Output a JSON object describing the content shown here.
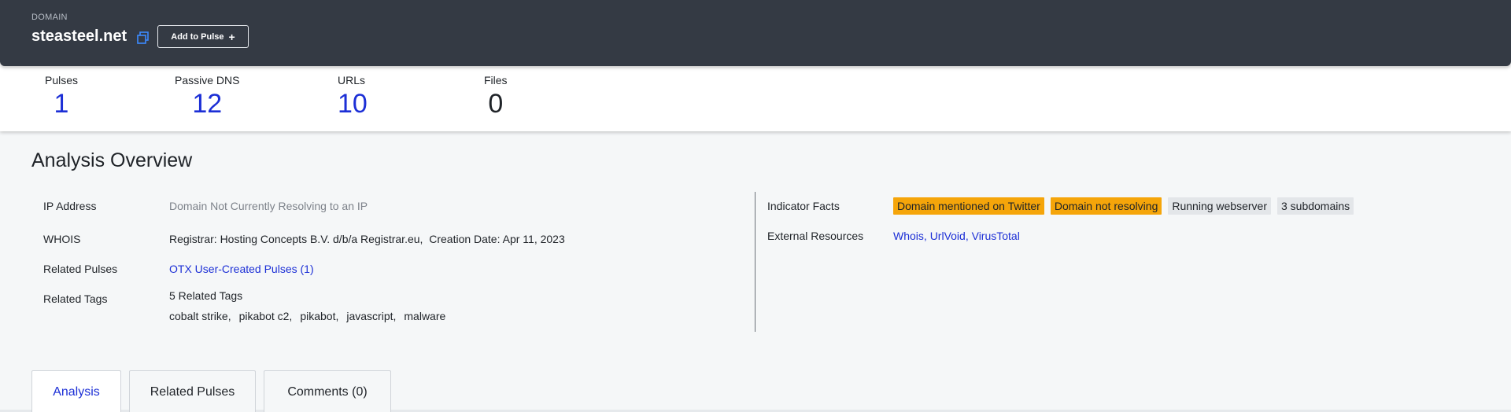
{
  "header": {
    "type_label": "DOMAIN",
    "domain": "steasteel.net",
    "add_button_label": "Add to Pulse",
    "copy_icon": "copy-icon",
    "plus_icon": "+"
  },
  "stats": {
    "pulses": {
      "label": "Pulses",
      "value": "1"
    },
    "passive_dns": {
      "label": "Passive DNS",
      "value": "12"
    },
    "urls": {
      "label": "URLs",
      "value": "10"
    },
    "files": {
      "label": "Files",
      "value": "0"
    }
  },
  "overview": {
    "title": "Analysis Overview",
    "ip_address": {
      "label": "IP Address",
      "value": "Domain Not Currently Resolving to an IP"
    },
    "whois": {
      "label": "WHOIS",
      "registrar": "Registrar: Hosting Concepts B.V. d/b/a Registrar.eu,",
      "creation": "Creation Date: Apr 11, 2023"
    },
    "related_pulses": {
      "label": "Related Pulses",
      "value": "OTX User-Created Pulses",
      "count": "(1)"
    },
    "related_tags": {
      "label": "Related Tags",
      "summary": "5 Related Tags",
      "tags": [
        "cobalt strike,",
        "pikabot c2,",
        "pikabot,",
        "javascript,",
        "malware"
      ]
    },
    "indicator_facts": {
      "label": "Indicator Facts",
      "badges": [
        "Domain mentioned on Twitter",
        "Domain not resolving",
        "Running webserver",
        "3 subdomains"
      ]
    },
    "external_resources": {
      "label": "External Resources",
      "links": [
        "Whois,",
        "UrlVoid,",
        "VirusTotal"
      ]
    }
  },
  "tabs": [
    "Analysis",
    "Related Pulses",
    "Comments (0)"
  ],
  "colors": {
    "accent": "#1c2fd6",
    "header_bg": "#343a44",
    "warning": "#f5a50a"
  }
}
